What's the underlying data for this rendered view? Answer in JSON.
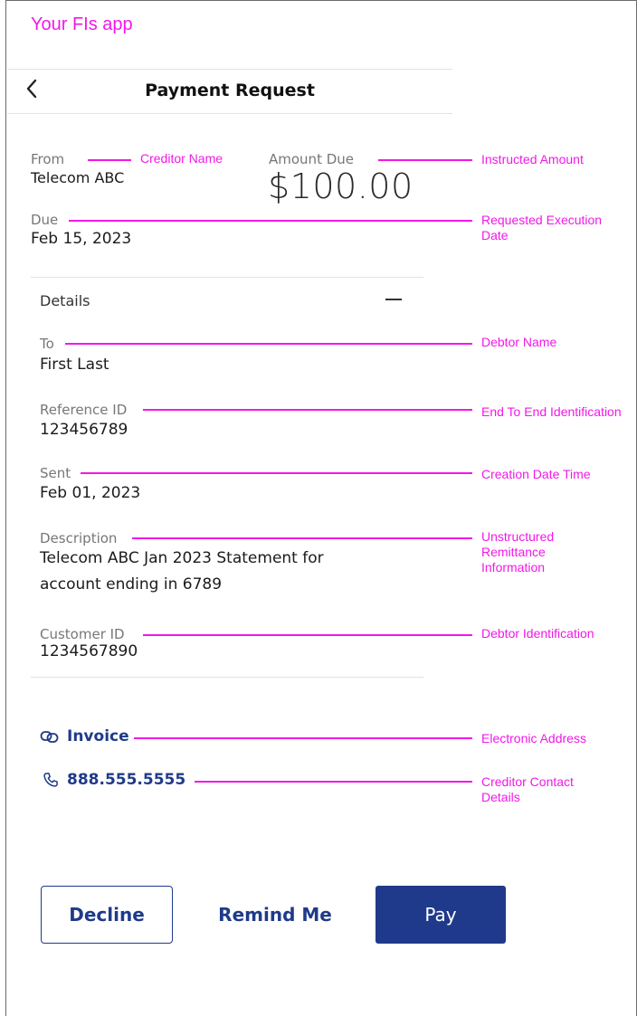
{
  "app": {
    "title": "Your FIs app"
  },
  "header": {
    "title": "Payment Request",
    "back_icon": "chevron-left-icon"
  },
  "summary": {
    "from_label": "From",
    "from_value": "Telecom ABC",
    "amount_label": "Amount Due",
    "amount_value": "$100.00",
    "due_label": "Due",
    "due_value": "Feb 15, 2023"
  },
  "details": {
    "title": "Details",
    "collapse_icon": "minus-icon",
    "to_label": "To",
    "to_value": "First Last",
    "reference_label": "Reference ID",
    "reference_value": "123456789",
    "sent_label": "Sent",
    "sent_value": "Feb 01, 2023",
    "description_label": "Description",
    "description_line1": "Telecom ABC Jan 2023 Statement for",
    "description_line2": "account ending in 6789",
    "customer_label": "Customer ID",
    "customer_value": "1234567890"
  },
  "links": {
    "invoice_label": "Invoice",
    "invoice_icon": "link-icon",
    "phone_label": "888.555.5555",
    "phone_icon": "phone-icon"
  },
  "annotations": {
    "creditor_name": "Creditor Name",
    "instructed_amount": "Instructed Amount",
    "requested_execution_date": "Requested Execution Date",
    "debtor_name": "Debtor Name",
    "end_to_end_identification": "End To End Identification",
    "creation_date_time": "Creation Date Time",
    "unstructured_remittance_information": "Unstructured Remittance Information",
    "debtor_identification": "Debtor Identification",
    "electronic_address": "Electronic Address",
    "creditor_contact_details": "Creditor Contact Details"
  },
  "actions": {
    "decline_label": "Decline",
    "remind_label": "Remind Me",
    "pay_label": "Pay"
  },
  "colors": {
    "annotation": "#f218e8",
    "primary": "#1f3a8a",
    "divider": "#e2e2e2"
  }
}
